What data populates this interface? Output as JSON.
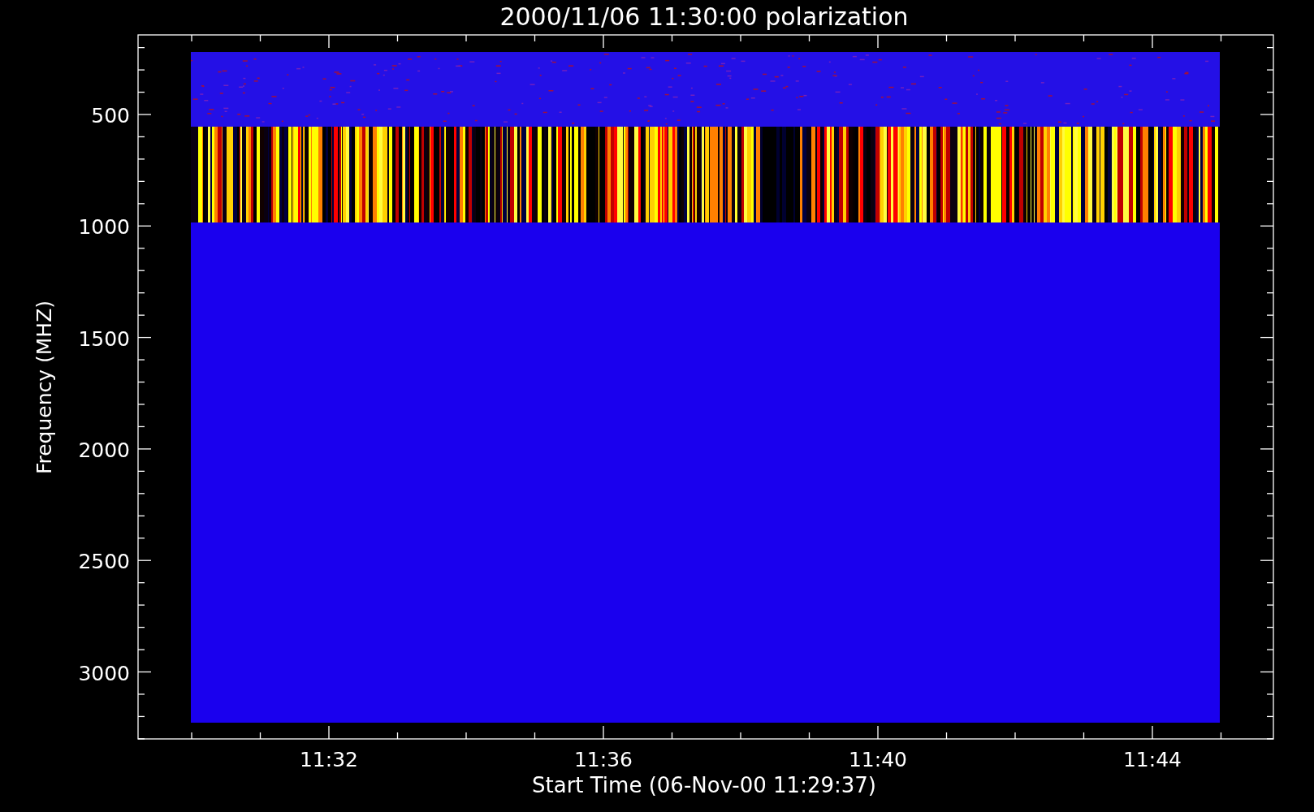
{
  "plot": {
    "title": "2000/11/06 11:30:00 polarization",
    "ylabel": "Frequency (MHZ)",
    "xlabel": "Start Time (06-Nov-00 11:29:37)",
    "yticks": [
      "500",
      "1000",
      "1500",
      "2000",
      "2500",
      "3000"
    ],
    "xticks": [
      "11:32",
      "11:36",
      "11:40",
      "11:44"
    ]
  }
}
